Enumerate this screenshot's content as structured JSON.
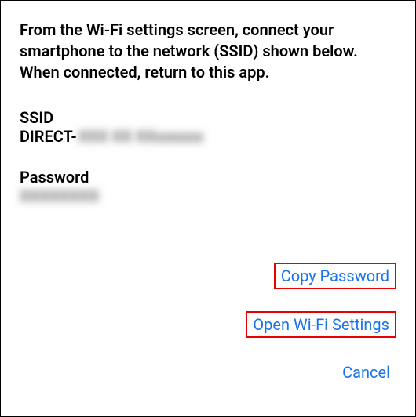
{
  "instruction": "From the Wi-Fi settings screen, connect your smartphone to the network (SSID) shown below. When connected, return to this app.",
  "ssid": {
    "label": "SSID",
    "prefix": "DIRECT-",
    "value_masked": "XXX XX XXxxxxxx"
  },
  "password": {
    "label": "Password",
    "value_masked": "XXXXXXXX"
  },
  "actions": {
    "copy_password": "Copy Password",
    "open_wifi_settings": "Open Wi-Fi Settings",
    "cancel": "Cancel"
  }
}
